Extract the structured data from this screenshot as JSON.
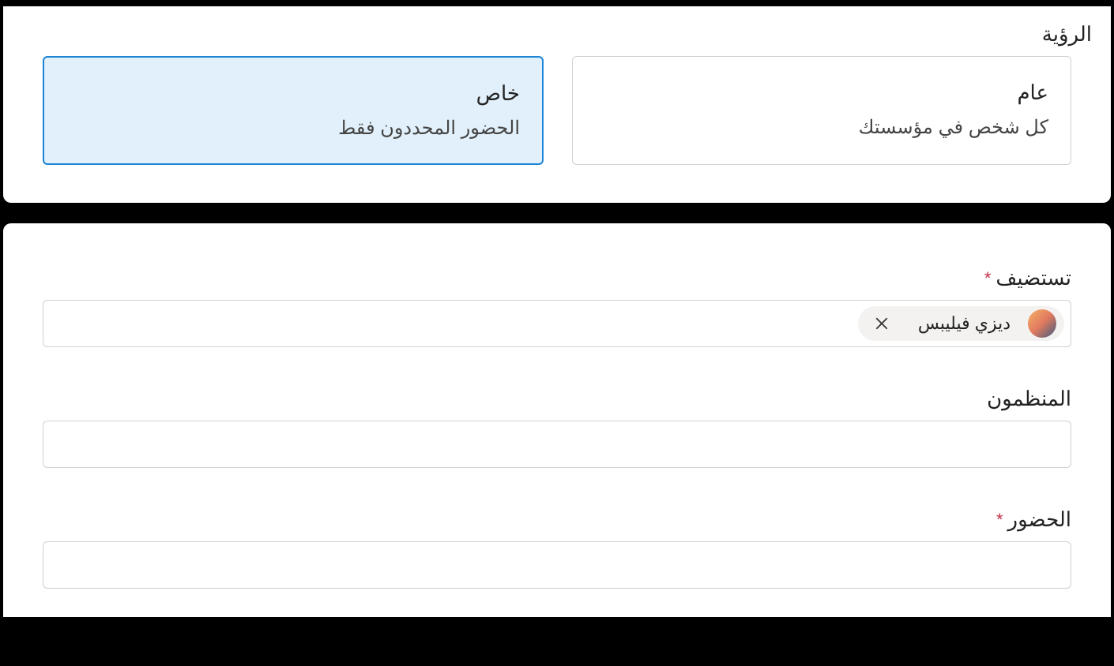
{
  "visibility": {
    "section_label": "الرؤية",
    "options": [
      {
        "title": "عام",
        "desc": "كل شخص في مؤسستك"
      },
      {
        "title": "خاص",
        "desc": "الحضور المحددون فقط"
      }
    ]
  },
  "hosts": {
    "label": "تستضيف",
    "chip_name": "ديزي فيليبس"
  },
  "organizers": {
    "label": "المنظمون"
  },
  "attendees": {
    "label": "الحضور"
  }
}
